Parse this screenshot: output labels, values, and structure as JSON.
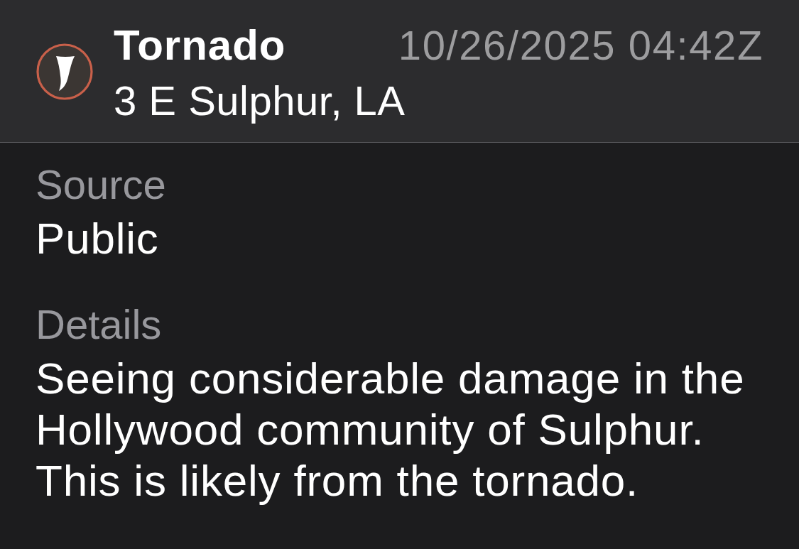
{
  "report": {
    "kind": "tornado",
    "title": "Tornado",
    "timestamp": "10/26/2025 04:42Z",
    "location": "3 E Sulphur, LA"
  },
  "fields": [
    {
      "label": "Source",
      "value": "Public"
    },
    {
      "label": "Details",
      "value": "Seeing considerable damage in the Hollywood community of Sulphur. This is likely from the tornado."
    }
  ]
}
